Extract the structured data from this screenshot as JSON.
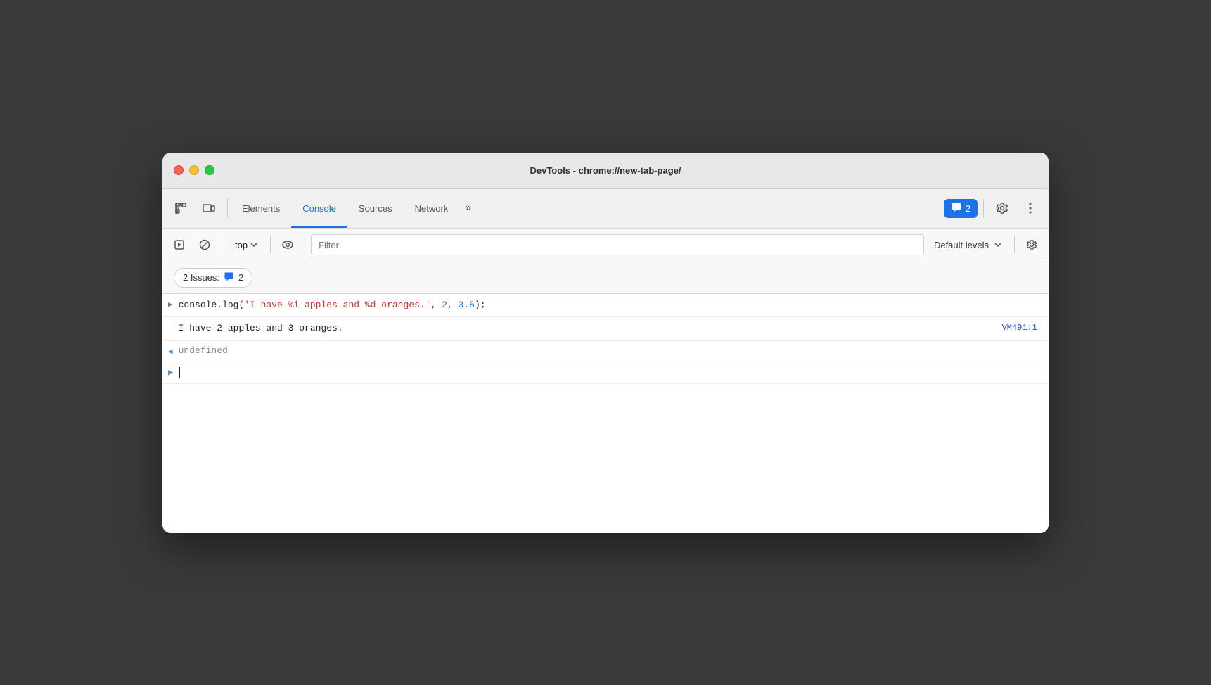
{
  "window": {
    "title": "DevTools - chrome://new-tab-page/"
  },
  "tabs": {
    "items": [
      {
        "id": "elements",
        "label": "Elements",
        "active": false
      },
      {
        "id": "console",
        "label": "Console",
        "active": true
      },
      {
        "id": "sources",
        "label": "Sources",
        "active": false
      },
      {
        "id": "network",
        "label": "Network",
        "active": false
      }
    ],
    "more_label": "»",
    "issues_count": "2",
    "issues_badge_label": "2"
  },
  "toolbar": {
    "top_label": "top",
    "filter_placeholder": "Filter",
    "default_levels_label": "Default levels"
  },
  "issues_bar": {
    "prefix": "2 Issues:",
    "count": "2"
  },
  "console": {
    "log_line": "console.log('I have %i apples and %d oranges.', 2, 3.5);",
    "output_line": "I have 2 apples and 3 oranges.",
    "vm_link": "VM491:1",
    "undefined_text": "undefined"
  },
  "colors": {
    "accent": "#1a73e8",
    "tab_active_underline": "#1a73e8",
    "traffic_close": "#ff5f57",
    "traffic_minimize": "#ffbd2e",
    "traffic_maximize": "#28c940"
  }
}
